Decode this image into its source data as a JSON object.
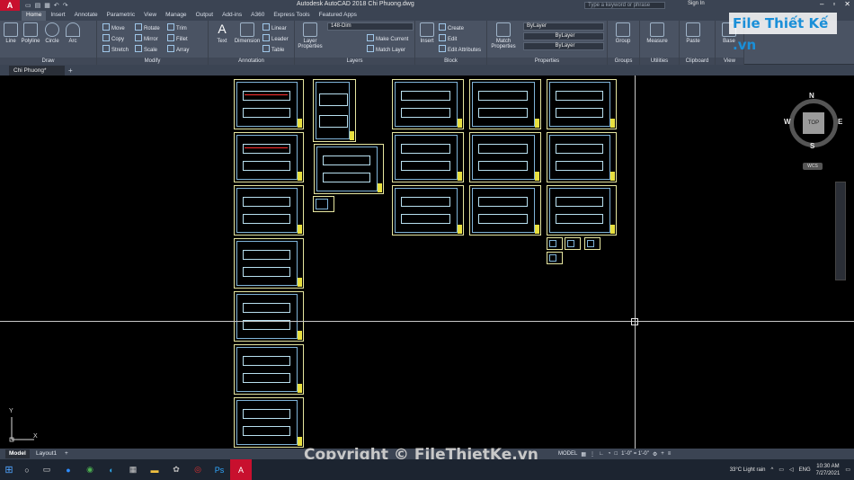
{
  "app": {
    "logo": "A",
    "title": "Autodesk AutoCAD 2018    Chi Phuong.dwg",
    "search_placeholder": "Type a keyword or phrase",
    "sign_in": "Sign In"
  },
  "ribbon_tabs": [
    "Home",
    "Insert",
    "Annotate",
    "Parametric",
    "View",
    "Manage",
    "Output",
    "Add-ins",
    "A360",
    "Express Tools",
    "Featured Apps"
  ],
  "ribbon": {
    "draw": {
      "label": "Draw",
      "tools": [
        "Line",
        "Polyline",
        "Circle",
        "Arc"
      ]
    },
    "modify": {
      "label": "Modify",
      "tools": [
        "Move",
        "Rotate",
        "Trim",
        "Copy",
        "Mirror",
        "Fillet",
        "Stretch",
        "Scale",
        "Array"
      ]
    },
    "annotation": {
      "label": "Annotation",
      "tools": [
        "Text",
        "Dimension",
        "Linear",
        "Leader",
        "Table"
      ]
    },
    "layers": {
      "label": "Layers",
      "tools": [
        "Layer Properties",
        "Make Current",
        "Match Layer"
      ],
      "current_layer": "148-Dim"
    },
    "block": {
      "label": "Block",
      "tools": [
        "Insert",
        "Create",
        "Edit",
        "Edit Attributes"
      ]
    },
    "properties": {
      "label": "Properties",
      "tools": [
        "Match Properties"
      ],
      "color": "ByLayer",
      "linetype": "ByLayer",
      "lineweight": "ByLayer"
    },
    "groups": {
      "label": "Groups",
      "tools": [
        "Group"
      ]
    },
    "utilities": {
      "label": "Utilities",
      "tools": [
        "Measure"
      ]
    },
    "clipboard": {
      "label": "Clipboard",
      "tools": [
        "Paste"
      ]
    },
    "view": {
      "label": "View",
      "tools": [
        "Base"
      ]
    }
  },
  "doc_tab": "Chi Phuong*",
  "viewcube": {
    "n": "N",
    "s": "S",
    "w": "W",
    "e": "E",
    "top": "TOP",
    "wcs": "WCS"
  },
  "ucs": {
    "x": "X",
    "y": "Y"
  },
  "layout_tabs": [
    "Model",
    "Layout1"
  ],
  "status": {
    "model": "MODEL",
    "scale": "1'-0\" = 1'-0\""
  },
  "watermark": {
    "copyright": "Copyright © FileThietKe.vn",
    "brand": "File Thiết Kế .vn"
  },
  "taskbar": {
    "weather": "33°C  Light rain",
    "lang": "ENG",
    "time": "10:30 AM",
    "date": "7/27/2021"
  },
  "colors": {
    "accent": "#c8102e",
    "sheet_border": "#e6e6a0",
    "ribbon_bg": "#4a5363"
  }
}
